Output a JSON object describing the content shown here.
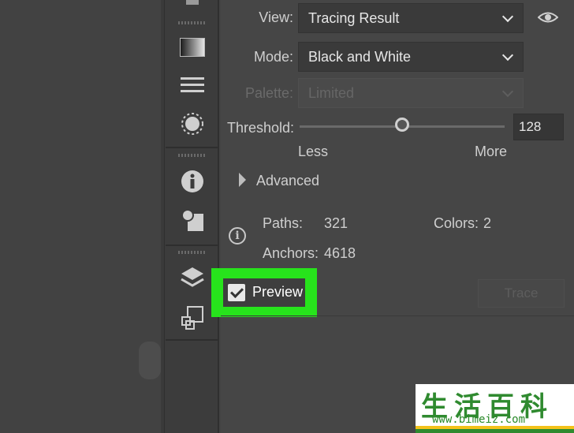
{
  "panel": {
    "view": {
      "label": "View:",
      "value": "Tracing Result"
    },
    "mode": {
      "label": "Mode:",
      "value": "Black and White"
    },
    "palette": {
      "label": "Palette:",
      "value": "Limited"
    },
    "threshold": {
      "label": "Threshold:",
      "value": "128",
      "slider_fraction": 0.5,
      "min_label": "Less",
      "max_label": "More"
    },
    "advanced_label": "Advanced",
    "stats": {
      "paths_label": "Paths:",
      "paths_value": "321",
      "colors_label": "Colors:",
      "colors_value": "2",
      "anchors_label": "Anchors:",
      "anchors_value": "4618"
    },
    "preview": {
      "label": "Preview",
      "checked": true
    },
    "trace_label": "Trace"
  },
  "icons": [
    "gradient-icon",
    "stroke-lines-icon",
    "appearance-circle-icon",
    "info-icon",
    "shape-builder-icon",
    "layers-icon",
    "transform-icon",
    "eye-icon"
  ],
  "colors": {
    "highlight": "#27e31c",
    "panel_bg": "#464646"
  },
  "watermark": {
    "chars": "生活百科",
    "url": "www.bimeiz.com"
  }
}
